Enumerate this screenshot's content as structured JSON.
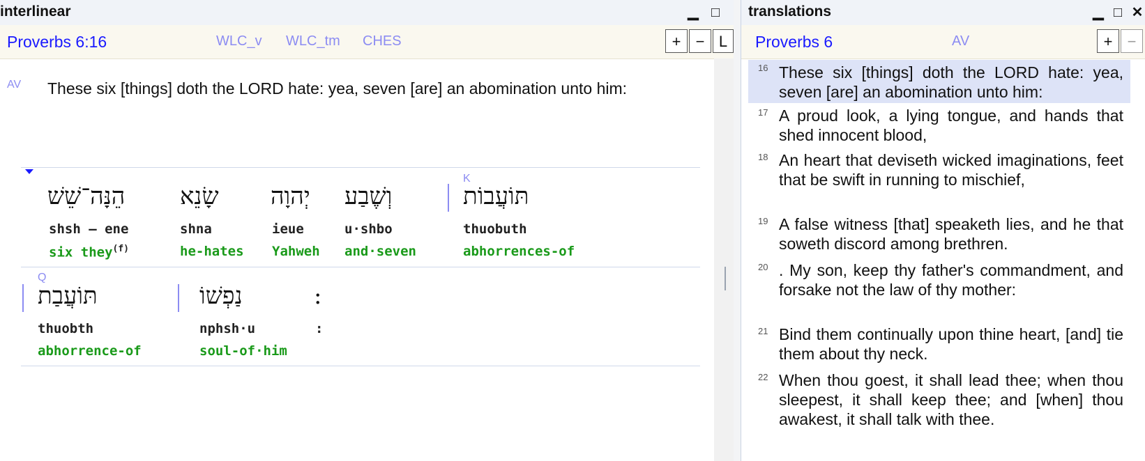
{
  "interlinear": {
    "title": "interlinear",
    "reference": "Proverbs 6:16",
    "versions": [
      "WLC_v",
      "WLC_tm",
      "CHES"
    ],
    "buttons": {
      "plus": "+",
      "minus": "−",
      "layout": "L"
    },
    "verse": {
      "tag": "AV",
      "text": "These six [things] doth the LORD hate: yea, seven [are] an abomination unto him:"
    },
    "row1": {
      "words": [
        {
          "hebrew": "הֵנָּה־שֵׁשׁ",
          "translit": "shsh – ene",
          "gloss": "six  they",
          "gloss_sup": "(f)"
        },
        {
          "hebrew": "שָׂנֵא",
          "translit": "shna",
          "gloss": "he-hates"
        },
        {
          "hebrew": "יְהוָה",
          "translit": "ieue",
          "gloss": "Yahweh"
        },
        {
          "hebrew": "וְשֶׁבַע",
          "translit": "u·shbo",
          "gloss": "and·seven"
        },
        {
          "hebrew": "תּוֹעֲבוֹת",
          "translit": "thuobuth",
          "gloss": "abhorrences-of",
          "mark": "K"
        }
      ]
    },
    "row2": {
      "words": [
        {
          "hebrew": "תּוֹעֲבַת",
          "translit": "thuobth",
          "gloss": "abhorrence-of",
          "mark": "Q"
        },
        {
          "hebrew": "נַפְשׁוֹ",
          "translit": "nphsh·u",
          "gloss": "soul-of·him"
        },
        {
          "hebrew": ":",
          "translit": ":",
          "gloss": ""
        }
      ]
    }
  },
  "translations": {
    "title": "translations",
    "reference": "Proverbs 6",
    "version": "AV",
    "buttons": {
      "plus": "+",
      "minus": "−"
    },
    "verses": [
      {
        "num": "16",
        "text": "These six [things] doth the LORD hate: yea, seven [are] an abomination unto him:",
        "selected": true
      },
      {
        "num": "17",
        "text": "A proud look, a lying tongue, and hands that shed innocent blood,"
      },
      {
        "num": "18",
        "text": "An heart that deviseth wicked imaginations, feet that be swift in running to mischief,"
      },
      {
        "num": "19",
        "text": "A false witness [that] speaketh lies, and he that soweth discord among brethren."
      },
      {
        "num": "20",
        "text": ". My son, keep thy father's commandment, and forsake not the law of thy mother:"
      },
      {
        "num": "21",
        "text": "Bind them continually upon thine heart, [and] tie them about thy neck."
      },
      {
        "num": "22",
        "text": "When thou goest, it shall lead thee; when thou sleepest, it shall keep thee; and [when] thou awakest, it shall talk with thee."
      }
    ]
  },
  "window_buttons": {
    "minimize": "▁",
    "maximize": "□",
    "close": "✕"
  }
}
